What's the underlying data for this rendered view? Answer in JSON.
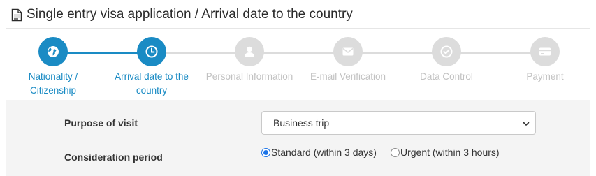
{
  "header": {
    "title": "Single entry visa application / Arrival date to the country",
    "icon": "document-icon"
  },
  "colors": {
    "accent": "#1a8bc4",
    "inactive": "#dcdcdc",
    "inactive_text": "#c2c2c2",
    "panel_bg": "#f4f4f4"
  },
  "steps": [
    {
      "label_line1": "Nationality /",
      "label_line2": "Citizenship",
      "icon": "globe-icon",
      "state": "active"
    },
    {
      "label_line1": "Arrival date to the",
      "label_line2": "country",
      "icon": "clock-icon",
      "state": "active"
    },
    {
      "label_line1": "Personal Information",
      "label_line2": "",
      "icon": "user-icon",
      "state": "inactive"
    },
    {
      "label_line1": "E-mail Verification",
      "label_line2": "",
      "icon": "envelope-icon",
      "state": "inactive"
    },
    {
      "label_line1": "Data Control",
      "label_line2": "",
      "icon": "check-icon",
      "state": "inactive"
    },
    {
      "label_line1": "Payment",
      "label_line2": "",
      "icon": "credit-card-icon",
      "state": "inactive"
    }
  ],
  "form": {
    "purpose_label": "Purpose of visit",
    "purpose_value": "Business trip",
    "period_label": "Consideration period",
    "period_options": [
      {
        "label": "Standard (within 3 days)",
        "checked": true
      },
      {
        "label": "Urgent (within 3 hours)",
        "checked": false
      }
    ]
  }
}
